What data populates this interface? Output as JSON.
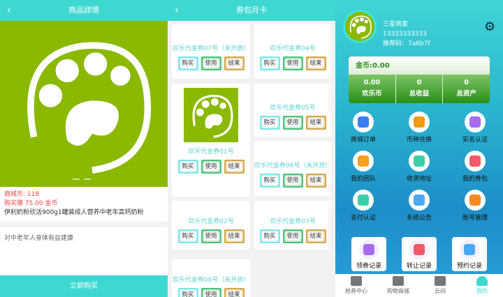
{
  "detail": {
    "title": "商品詳情",
    "coin": "商城币: 118",
    "gift": "购买赠 75.00 金币",
    "name": "伊利奶粉欣活900g1罐装成人营养中老年高钙奶粉",
    "desc": "对中老年人身体有益建康",
    "buy": "立即购买"
  },
  "coupons": {
    "title": "券包月卡",
    "buy": "购买",
    "use": "使用",
    "end": "结束",
    "items": [
      "欢乐代金券07号（未开放）",
      "欢乐代金券04号",
      "欢乐代金券01号",
      "欢乐代金券05号",
      "欢乐代金券06号（未开放）",
      "欢乐代金券02号",
      "欢乐代金券03号",
      "欢乐代金券08号（未开放）"
    ]
  },
  "profile": {
    "name": "三星商家",
    "phone": "13333333333",
    "ref": "推荐码：7a6b7f",
    "gold": "金币:0.00",
    "stats": [
      {
        "v": "0.00",
        "l": "欢乐币"
      },
      {
        "v": "0",
        "l": "总收益"
      },
      {
        "v": "0",
        "l": "总资产"
      }
    ],
    "menu": [
      "商城订单",
      "币种兑换",
      "实名认证",
      "我的团队",
      "收货地址",
      "我的券包",
      "支付认证",
      "系统公告",
      "账号管理"
    ],
    "records": [
      "领券记录",
      "转让记录",
      "预约记录"
    ],
    "tabs": [
      "抢券中心",
      "购物商城",
      "云间",
      "我的"
    ]
  },
  "colors": {
    "accent": "#3ed8d2",
    "brand_green": "#8ab900",
    "active_tab": "#3ed8d2"
  }
}
